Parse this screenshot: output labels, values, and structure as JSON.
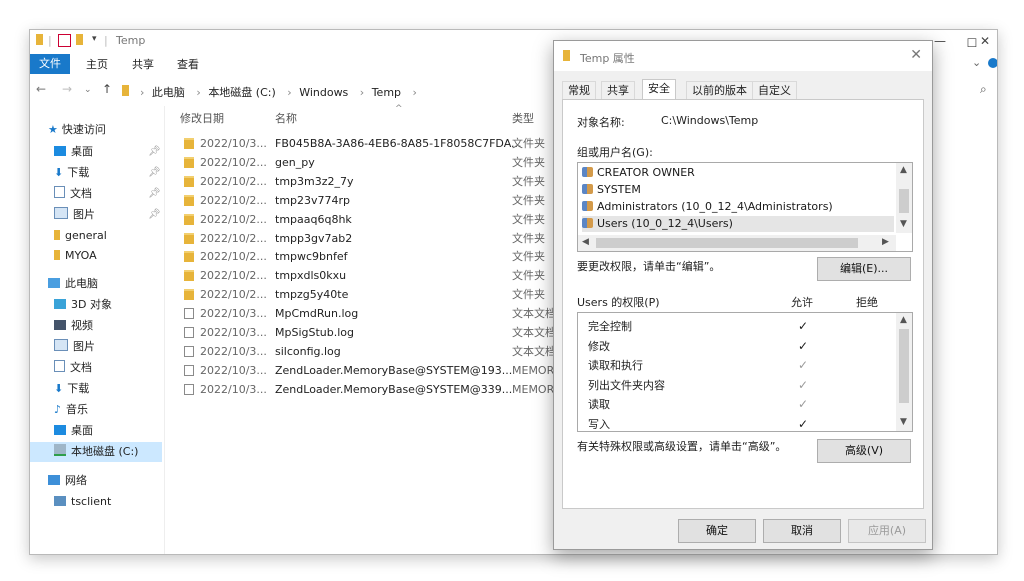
{
  "explorer": {
    "title": "Temp",
    "ribbon_tabs": [
      "文件",
      "主页",
      "共享",
      "查看"
    ],
    "breadcrumb": [
      "此电脑",
      "本地磁盘 (C:)",
      "Windows",
      "Temp"
    ],
    "columns": {
      "date": "修改日期",
      "name": "名称",
      "type": "类型"
    },
    "nav": {
      "quick_access": "快速访问",
      "quick_items": [
        "桌面",
        "下载",
        "文档",
        "图片",
        "general",
        "MYOA"
      ],
      "this_pc": "此电脑",
      "pc_items": [
        "3D 对象",
        "视频",
        "图片",
        "文档",
        "下载",
        "音乐",
        "桌面",
        "本地磁盘 (C:)"
      ],
      "network": "网络",
      "tsclient": "tsclient"
    },
    "files": [
      {
        "date": "2022/10/3...",
        "name": "FB045B8A-3A86-4EB6-8A85-1F8058C7FDA...",
        "type": "文件夹",
        "icon": "folder-icon"
      },
      {
        "date": "2022/10/2...",
        "name": "gen_py",
        "type": "文件夹",
        "icon": "folder-icon"
      },
      {
        "date": "2022/10/2...",
        "name": "tmp3m3z2_7y",
        "type": "文件夹",
        "icon": "folder-icon"
      },
      {
        "date": "2022/10/2...",
        "name": "tmp23v774rp",
        "type": "文件夹",
        "icon": "folder-icon"
      },
      {
        "date": "2022/10/2...",
        "name": "tmpaaq6q8hk",
        "type": "文件夹",
        "icon": "folder-icon"
      },
      {
        "date": "2022/10/2...",
        "name": "tmpp3gv7ab2",
        "type": "文件夹",
        "icon": "folder-icon"
      },
      {
        "date": "2022/10/2...",
        "name": "tmpwc9bnfef",
        "type": "文件夹",
        "icon": "folder-icon"
      },
      {
        "date": "2022/10/2...",
        "name": "tmpxdls0kxu",
        "type": "文件夹",
        "icon": "folder-icon"
      },
      {
        "date": "2022/10/2...",
        "name": "tmpzg5y40te",
        "type": "文件夹",
        "icon": "folder-icon"
      },
      {
        "date": "2022/10/3...",
        "name": "MpCmdRun.log",
        "type": "文本文档",
        "icon": "log-file-icon"
      },
      {
        "date": "2022/10/3...",
        "name": "MpSigStub.log",
        "type": "文本文档",
        "icon": "log-file-icon"
      },
      {
        "date": "2022/10/3...",
        "name": "silconfig.log",
        "type": "文本文档",
        "icon": "log-file-icon"
      },
      {
        "date": "2022/10/3...",
        "name": "ZendLoader.MemoryBase@SYSTEM@193...",
        "type": "MEMOR",
        "icon": "file-icon"
      },
      {
        "date": "2022/10/3...",
        "name": "ZendLoader.MemoryBase@SYSTEM@339...",
        "type": "MEMOR",
        "icon": "file-icon"
      }
    ]
  },
  "dialog": {
    "title": "Temp 属性",
    "tabs": [
      "常规",
      "共享",
      "安全",
      "以前的版本",
      "自定义"
    ],
    "active_tab": "安全",
    "object_label": "对象名称:",
    "object_value": "C:\\Windows\\Temp",
    "group_label": "组或用户名(G):",
    "users": [
      "CREATOR OWNER",
      "SYSTEM",
      "Administrators (10_0_12_4\\Administrators)",
      "Users (10_0_12_4\\Users)"
    ],
    "edit_hint": "要更改权限，请单击“编辑”。",
    "edit_button": "编辑(E)...",
    "perm_header": "Users 的权限(P)",
    "allow_header": "允许",
    "deny_header": "拒绝",
    "permissions": [
      {
        "name": "完全控制",
        "allow": "✓",
        "style": "on"
      },
      {
        "name": "修改",
        "allow": "✓",
        "style": "on"
      },
      {
        "name": "读取和执行",
        "allow": "✓",
        "style": "grey"
      },
      {
        "name": "列出文件夹内容",
        "allow": "✓",
        "style": "grey"
      },
      {
        "name": "读取",
        "allow": "✓",
        "style": "grey"
      },
      {
        "name": "写入",
        "allow": "✓",
        "style": "on"
      }
    ],
    "advanced_hint": "有关特殊权限或高级设置，请单击“高级”。",
    "advanced_button": "高级(V)",
    "ok_button": "确定",
    "cancel_button": "取消",
    "apply_button": "应用(A)"
  },
  "colors": {
    "accent": "#1979ca",
    "folder": "#e7b43a",
    "selection": "#cce8ff"
  }
}
